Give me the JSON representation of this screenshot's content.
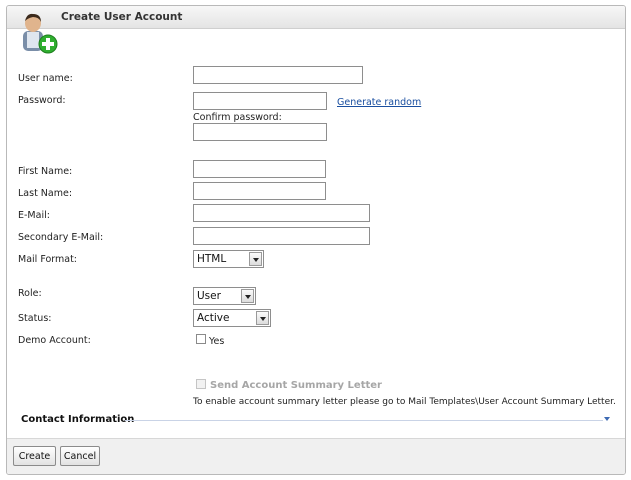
{
  "window": {
    "title": "Create User Account"
  },
  "form": {
    "username_label": "User name:",
    "username_value": "",
    "password_label": "Password:",
    "password_value": "",
    "generate_random_link": "Generate random",
    "confirm_password_label": "Confirm password:",
    "confirm_password_value": "",
    "first_name_label": "First Name:",
    "first_name_value": "",
    "last_name_label": "Last Name:",
    "last_name_value": "",
    "email_label": "E-Mail:",
    "email_value": "",
    "secondary_email_label": "Secondary E-Mail:",
    "secondary_email_value": "",
    "mail_format_label": "Mail Format:",
    "mail_format_value": "HTML",
    "role_label": "Role:",
    "role_value": "User",
    "status_label": "Status:",
    "status_value": "Active",
    "demo_account_label": "Demo Account:",
    "demo_account_checkbox_label": "Yes",
    "demo_account_checked": false,
    "send_summary_label": "Send Account Summary Letter",
    "send_summary_checked": false,
    "summary_hint": "To enable account summary letter please go to Mail Templates\\User Account Summary Letter."
  },
  "sections": {
    "contact_information": "Contact Information"
  },
  "footer": {
    "create_label": "Create",
    "cancel_label": "Cancel"
  },
  "colors": {
    "link": "#1a4fa0",
    "accent": "#3d6ab3",
    "add_badge": "#2fae2f"
  },
  "icons": {
    "header": "user-add-icon",
    "section_toggle": "chevron-down-icon"
  }
}
